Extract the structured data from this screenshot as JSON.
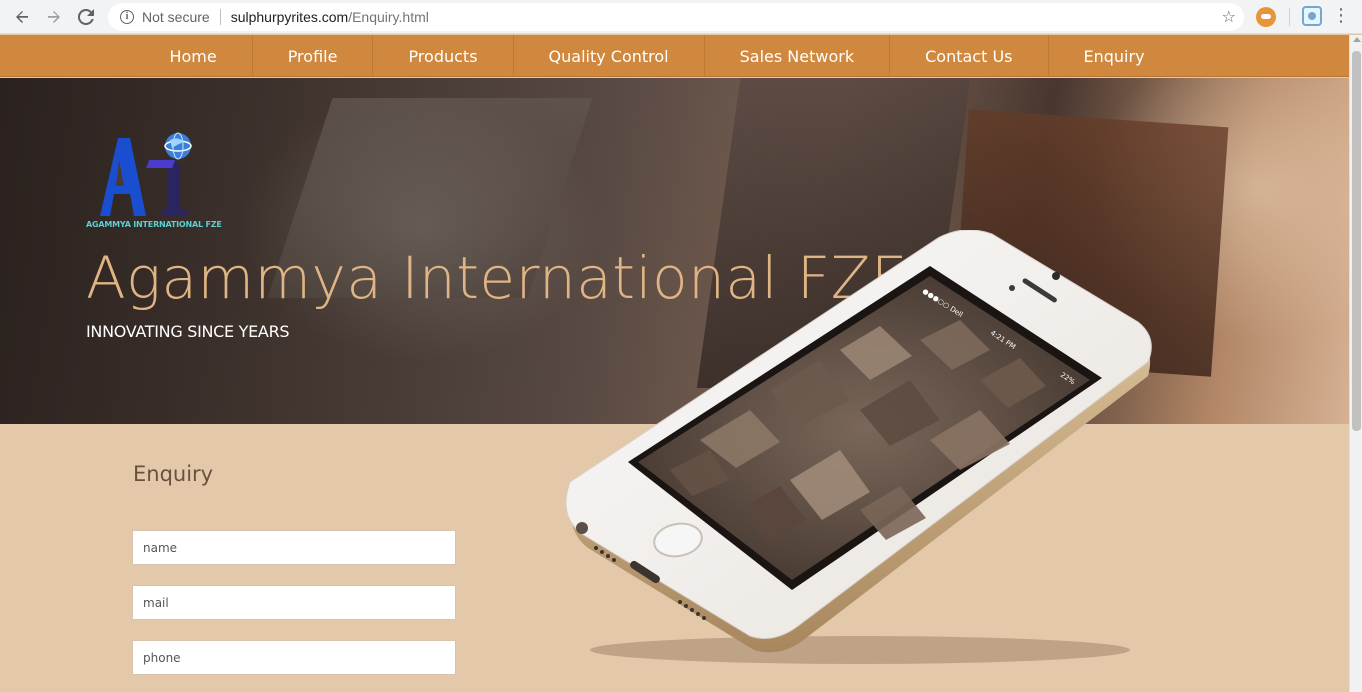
{
  "browser": {
    "security_label": "Not secure",
    "url_host": "sulphurpyrites.com",
    "url_path": "/Enquiry.html",
    "icons": [
      "back-icon",
      "forward-icon",
      "reload-icon",
      "info-icon",
      "star-icon",
      "extension-icon",
      "profile-icon",
      "menu-icon"
    ]
  },
  "site_nav": {
    "items": [
      "Home",
      "Profile",
      "Products",
      "Quality Control",
      "Sales Network",
      "Contact Us",
      "Enquiry"
    ]
  },
  "hero": {
    "logo_letters": "AI",
    "logo_caption": "AGAMMYA INTERNATIONAL FZE",
    "title": "Agammya International FZE",
    "tagline": "INNOVATING SINCE YEARS"
  },
  "phone_screen": {
    "carrier": "●●●○○ Dell",
    "time": "4:21 PM",
    "battery": "22%"
  },
  "enquiry": {
    "heading": "Enquiry",
    "name_placeholder": "name",
    "mail_placeholder": "mail",
    "phone_placeholder": "phone"
  },
  "colors": {
    "nav_bg": "#d0883e",
    "page_bg": "#e3c9a9",
    "title_color": "#e0b585",
    "logo_blue": "#1a4ed0",
    "logo_caption": "#5ad0d0"
  }
}
